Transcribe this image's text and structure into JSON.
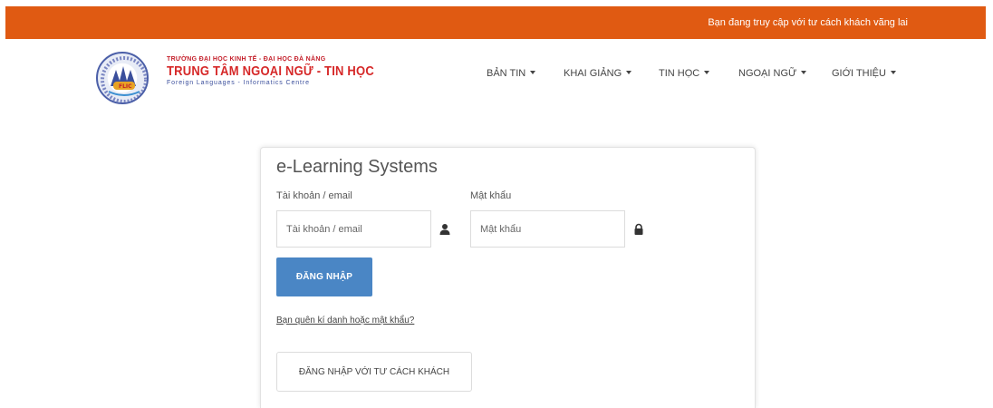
{
  "topbar": {
    "guest_notice": "Bạn đang truy cập với tư cách khách vãng lai",
    "color": "#e05a12"
  },
  "brand": {
    "line1": "TRƯỜNG ĐẠI HỌC KINH TẾ - ĐẠI HỌC ĐÀ NẴNG",
    "line2": "TRUNG TÂM NGOẠI NGỮ - TIN HỌC",
    "line3": "Foreign Languages - Informatics Centre",
    "logo_text": "FLIC"
  },
  "nav": {
    "items": [
      {
        "label": "BẢN TIN"
      },
      {
        "label": "KHAI GIẢNG"
      },
      {
        "label": "TIN HỌC"
      },
      {
        "label": "NGOẠI NGỮ"
      },
      {
        "label": "GIỚI THIỆU"
      }
    ]
  },
  "login": {
    "title": "e-Learning Systems",
    "username_label": "Tài khoản / email",
    "username_placeholder": "Tài khoản / email",
    "username_icon": "user-icon",
    "password_label": "Mật khẩu",
    "password_placeholder": "Mật khẩu",
    "password_icon": "lock-icon",
    "submit_label": "ĐĂNG NHẬP",
    "forgot_label": "Bạn quên kí danh hoặc mật khẩu?",
    "guest_label": "ĐĂNG NHẬP VỚI TƯ CÁCH KHÁCH",
    "button_color": "#4a86c5"
  }
}
